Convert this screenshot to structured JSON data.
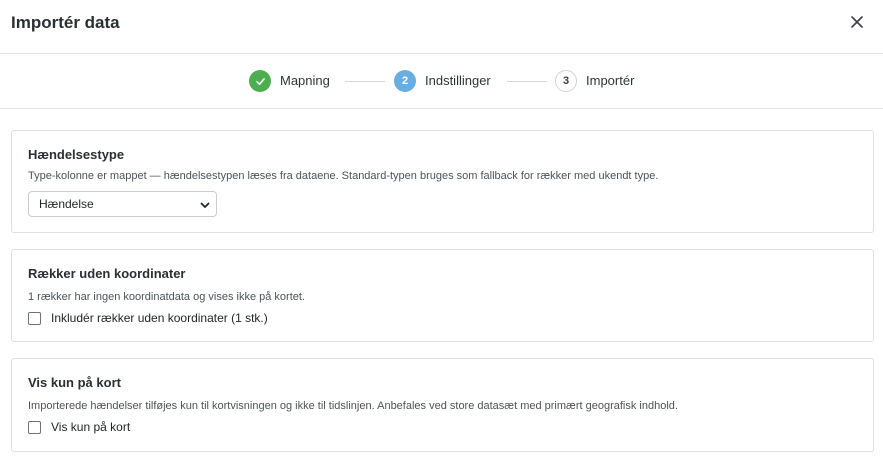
{
  "dialog": {
    "title": "Importér data",
    "close_icon": "close-icon"
  },
  "stepper": {
    "steps": [
      {
        "number": "1",
        "label": "Mapning",
        "state": "done",
        "icon": "check-icon"
      },
      {
        "number": "2",
        "label": "Indstillinger",
        "state": "active"
      },
      {
        "number": "3",
        "label": "Importér",
        "state": "pending"
      }
    ]
  },
  "sections": {
    "event_type": {
      "title": "Hændelsestype",
      "description": "Type-kolonne er mappet — hændelsestypen læses fra dataene. Standard-typen bruges som fallback for rækker med ukendt type.",
      "select_value": "Hændelse"
    },
    "no_coords": {
      "title": "Rækker uden koordinater",
      "description": "1 rækker har ingen koordinatdata og vises ikke på kortet.",
      "checkbox_label": "Inkludér rækker uden koordinater (1 stk.)",
      "checked": false
    },
    "map_only": {
      "title": "Vis kun på kort",
      "description": "Importerede hændelser tilføjes kun til kortvisningen og ikke til tidslinjen. Anbefales ved store datasæt med primært geografisk indhold.",
      "checkbox_label": "Vis kun på kort",
      "checked": false
    }
  },
  "colors": {
    "done": "#4cae4f",
    "active": "#6aaee0",
    "border": "#dde0e4"
  }
}
